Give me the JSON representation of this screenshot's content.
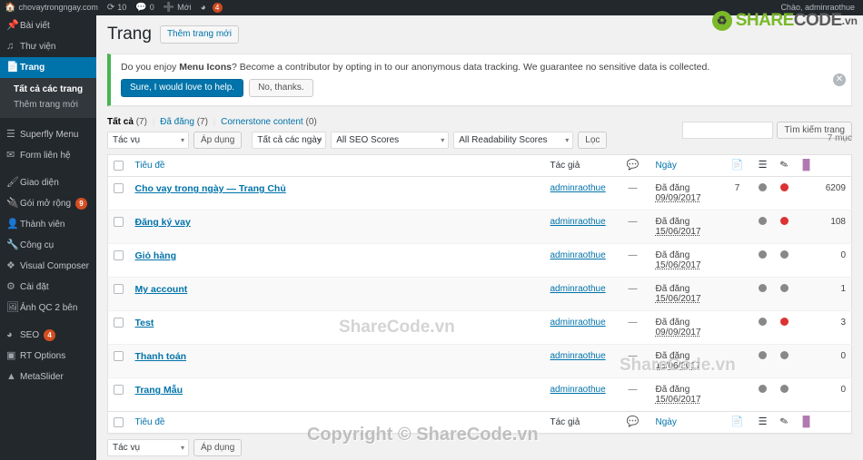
{
  "adminbar": {
    "site_icon": "home-icon",
    "site_name": "chovaytrongngay.com",
    "updates_icon": "updates-icon",
    "updates_count": "10",
    "comments_icon": "comment-icon",
    "comments_count": "0",
    "new_icon": "plus-icon",
    "new_label": "Mới",
    "seo_icon": "yoast-icon",
    "seo_count": "4",
    "greeting": "Chào, adminraothue"
  },
  "logo": {
    "mark": "recycle-icon",
    "share": "SHARE",
    "code": "CODE",
    "tld": ".vn"
  },
  "sidebar": {
    "items": [
      {
        "icon": "pin-icon",
        "label": "Bài viết",
        "badge": ""
      },
      {
        "icon": "media-icon",
        "label": "Thư viện",
        "badge": ""
      },
      {
        "icon": "pages-icon",
        "label": "Trang",
        "badge": ""
      }
    ],
    "submenu": [
      {
        "label": "Tất cả các trang",
        "current": true
      },
      {
        "label": "Thêm trang mới",
        "current": false
      }
    ],
    "items2": [
      {
        "icon": "menu-icon",
        "label": "Superfly Menu",
        "badge": ""
      },
      {
        "icon": "envelope-icon",
        "label": "Form liên hệ",
        "badge": ""
      }
    ],
    "items3": [
      {
        "icon": "appearance-icon",
        "label": "Giao diện",
        "badge": ""
      },
      {
        "icon": "plugin-icon",
        "label": "Gói mở rộng",
        "badge": "9"
      },
      {
        "icon": "user-icon",
        "label": "Thành viên",
        "badge": ""
      },
      {
        "icon": "tools-icon",
        "label": "Công cụ",
        "badge": ""
      },
      {
        "icon": "vc-icon",
        "label": "Visual Composer",
        "badge": ""
      },
      {
        "icon": "settings-icon",
        "label": "Cài đặt",
        "badge": ""
      },
      {
        "icon": "image-icon",
        "label": "Ảnh QC 2 bên",
        "badge": ""
      }
    ],
    "items4": [
      {
        "icon": "yoast-icon",
        "label": "SEO",
        "badge": "4"
      },
      {
        "icon": "rt-icon",
        "label": "RT Options",
        "badge": ""
      },
      {
        "icon": "slider-icon",
        "label": "MetaSlider",
        "badge": ""
      }
    ]
  },
  "page": {
    "title": "Trang",
    "add_new": "Thêm trang mới"
  },
  "notice": {
    "text_before": "Do you enjoy ",
    "text_bold": "Menu Icons",
    "text_after": "? Become a contributor by opting in to our anonymous data tracking. We guarantee no sensitive data is collected.",
    "accept_label": "Sure, I would love to help.",
    "decline_label": "No, thanks.",
    "dismiss_icon": "close-icon"
  },
  "views": {
    "all_label": "Tất cả",
    "all_count": "(7)",
    "published_label": "Đã đăng",
    "published_count": "(7)",
    "cornerstone_label": "Cornerstone content",
    "cornerstone_count": "(0)"
  },
  "search": {
    "value": "",
    "placeholder": "",
    "button_label": "Tìm kiếm trang"
  },
  "tablenav": {
    "bulk_action": "Tác vụ",
    "apply_label": "Áp dụng",
    "date_filter": "Tất cả các ngày",
    "seo_filter": "All SEO Scores",
    "readability_filter": "All Readability Scores",
    "filter_label": "Lọc",
    "displaying": "7 mục"
  },
  "table": {
    "headers": {
      "cb": "",
      "title": "Tiêu đề",
      "author": "Tác giả",
      "comments_icon": "comment-icon",
      "date": "Ngày",
      "links_icon": "seo-links-icon",
      "columns_icon": "seo-inbound-icon",
      "pen_icon": "readability-icon",
      "cap_icon": "seo-score-icon"
    },
    "rows": [
      {
        "title": "Cho vay trong ngày — Trang Chủ",
        "author": "adminraothue",
        "dash": "—",
        "comments": "7",
        "date_status": "Đã đăng",
        "date_value": "09/09/2017",
        "dot1": "grey",
        "dot2": "red",
        "num": "6209"
      },
      {
        "title": "Đăng ký vay",
        "author": "adminraothue",
        "dash": "—",
        "comments": "",
        "date_status": "Đã đăng",
        "date_value": "15/06/2017",
        "dot1": "grey",
        "dot2": "red",
        "num": "108"
      },
      {
        "title": "Giỏ hàng",
        "author": "adminraothue",
        "dash": "—",
        "comments": "",
        "date_status": "Đã đăng",
        "date_value": "15/06/2017",
        "dot1": "grey",
        "dot2": "grey",
        "num": "0"
      },
      {
        "title": "My account",
        "author": "adminraothue",
        "dash": "—",
        "comments": "",
        "date_status": "Đã đăng",
        "date_value": "15/06/2017",
        "dot1": "grey",
        "dot2": "grey",
        "num": "1"
      },
      {
        "title": "Test",
        "author": "adminraothue",
        "dash": "—",
        "comments": "",
        "date_status": "Đã đăng",
        "date_value": "09/09/2017",
        "dot1": "grey",
        "dot2": "red",
        "num": "3"
      },
      {
        "title": "Thanh toán",
        "author": "adminraothue",
        "dash": "—",
        "comments": "",
        "date_status": "Đã đăng",
        "date_value": "15/06/2017",
        "dot1": "grey",
        "dot2": "grey",
        "num": "0"
      },
      {
        "title": "Trang Mẫu",
        "author": "adminraothue",
        "dash": "—",
        "comments": "",
        "date_status": "Đã đăng",
        "date_value": "15/06/2017",
        "dot1": "grey",
        "dot2": "grey",
        "num": "0"
      }
    ]
  },
  "watermarks": {
    "wm1": "ShareCode.vn",
    "wm2": "ShareCode.vn",
    "wm3": "Copyright © ShareCode.vn"
  }
}
